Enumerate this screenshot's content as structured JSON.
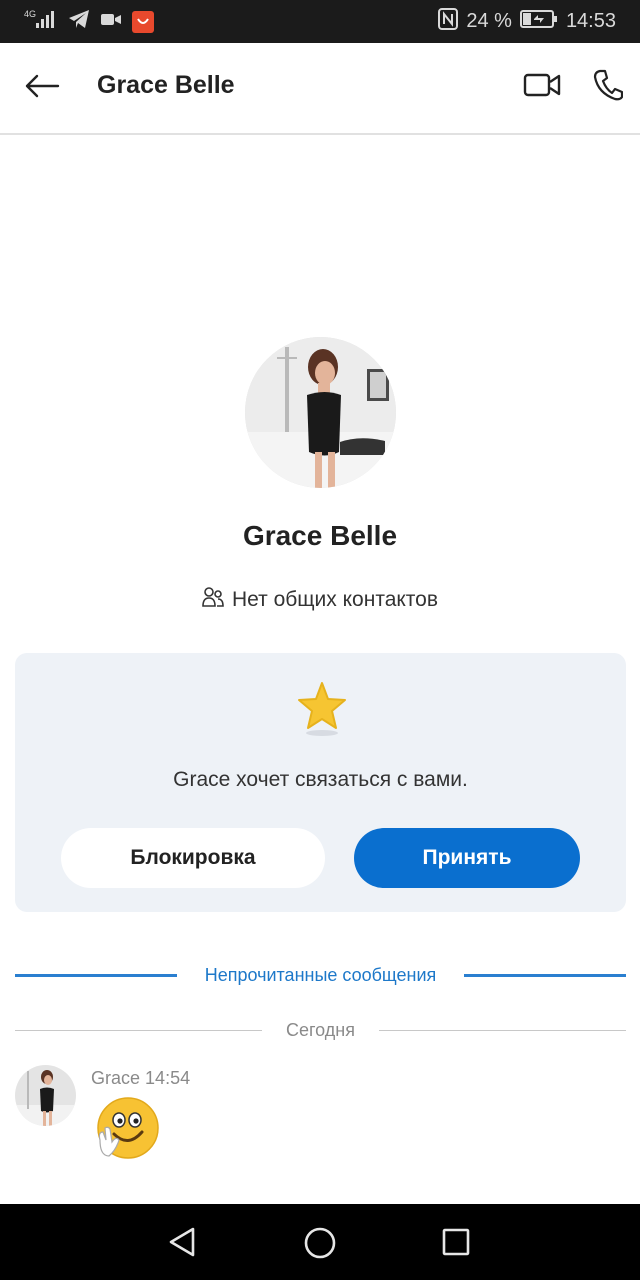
{
  "status_bar": {
    "network": "4G",
    "battery_percent": "24 %",
    "time": "14:53",
    "icons": [
      "signal-icon",
      "telegram-icon",
      "video-call-icon",
      "aliexpress-icon",
      "nfc-icon",
      "battery-icon"
    ]
  },
  "header": {
    "title": "Grace Belle",
    "icons": [
      "back-arrow-icon",
      "video-camera-icon",
      "phone-icon"
    ]
  },
  "profile": {
    "name": "Grace Belle",
    "contacts_label": "Нет общих контактов"
  },
  "request_card": {
    "message": "Grace хочет связаться с вами.",
    "block_label": "Блокировка",
    "accept_label": "Принять",
    "accent_color": "#0a6fcf"
  },
  "dividers": {
    "unread": "Непрочитанные сообщения",
    "today": "Сегодня"
  },
  "message": {
    "sender": "Grace",
    "time": "14:54",
    "emoji": "waving-smiley-emoji"
  },
  "navbar": {
    "icons": [
      "nav-back-icon",
      "nav-home-icon",
      "nav-recent-icon"
    ]
  }
}
